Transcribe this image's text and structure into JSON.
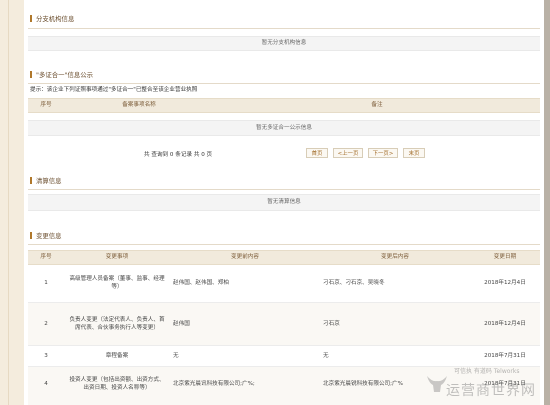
{
  "branch": {
    "title": "分支机构信息",
    "empty_text": "暂无分支机构信息"
  },
  "multi_cert": {
    "title": "\"多证合一\"信息公示",
    "hint": "提示：该企业下列证照事项通过\"多证合一\"已整合至该企业营业执照",
    "columns": [
      "序号",
      "备案事项名称",
      "备注"
    ],
    "empty_text": "暂无多证合一公示信息",
    "pager": {
      "summary": "共 查询到 0 条记录 共 0 页",
      "first": "首页",
      "prev": "<上一页",
      "next": "下一页>",
      "last": "末页"
    }
  },
  "liquidation": {
    "title": "清算信息",
    "empty_text": "暂无清算信息"
  },
  "changes": {
    "title": "变更信息",
    "columns": [
      "序号",
      "变更事项",
      "变更前内容",
      "变更后内容",
      "变更日期"
    ],
    "rows": [
      {
        "no": "1",
        "item": "高级管理人员备案（董事、监事、经理等）",
        "before": "赵伟国、赵伟国、郑柏",
        "after": "刁石京、刁石京、吴晓冬",
        "date": "2018年12月4日"
      },
      {
        "no": "2",
        "item": "负责人变更（法定代表人、负责人、首席代表、合伙事务执行人等变更）",
        "before": "赵伟国",
        "after": "刁石京",
        "date": "2018年12月4日"
      },
      {
        "no": "3",
        "item": "章程备案",
        "before": "无",
        "after": "无",
        "date": "2018年7月31日"
      },
      {
        "no": "4",
        "item": "投资人变更（包括出资额、出资方式、出资日期、投资人名称等）",
        "before": "北京紫光晨讯科技有限公司;广%;",
        "after": "北京紫光晨锐科技有限公司;广%",
        "date": "2018年7月31日"
      }
    ]
  },
  "watermark": {
    "line1": "可信执 有道码 Telworks",
    "line2": "运营商世界网"
  }
}
